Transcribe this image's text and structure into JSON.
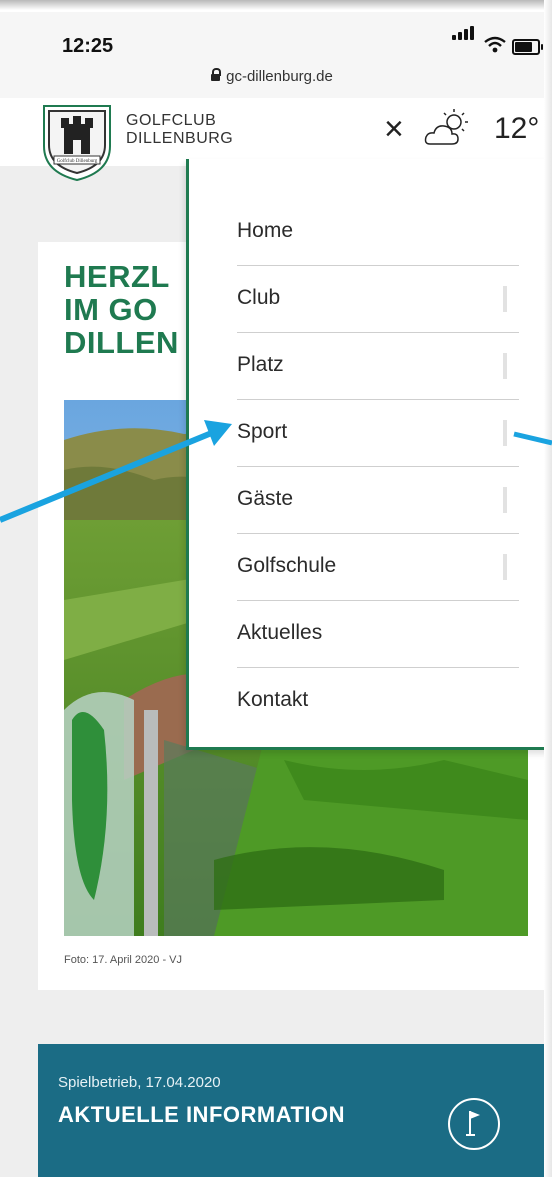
{
  "status_bar": {
    "time": "12:25",
    "url": "gc-dillenburg.de"
  },
  "header": {
    "brand_line1": "GOLFCLUB",
    "brand_line2": "DILLENBURG",
    "logo_text": "Golfclub Dillenburg",
    "close_symbol": "×",
    "temperature": "12°"
  },
  "hero": {
    "headline_lines": [
      "HERZLICH WILLKOMMEN",
      "IM GOLFCLUB",
      "DILLENBURG"
    ],
    "headline_visible": [
      "HERZL",
      "IM GO",
      "DILLEN"
    ],
    "caption": "Foto: 17. April 2020 - VJ"
  },
  "menu": {
    "items": [
      {
        "label": "Home",
        "has_toggle": false
      },
      {
        "label": "Club",
        "has_toggle": true
      },
      {
        "label": "Platz",
        "has_toggle": true
      },
      {
        "label": "Sport",
        "has_toggle": true
      },
      {
        "label": "Gäste",
        "has_toggle": true
      },
      {
        "label": "Golfschule",
        "has_toggle": true
      },
      {
        "label": "Aktuelles",
        "has_toggle": false
      },
      {
        "label": "Kontakt",
        "has_toggle": false
      }
    ]
  },
  "news": {
    "date": "Spielbetrieb, 17.04.2020",
    "title": "AKTUELLE INFORMATION",
    "icon": "flag-icon"
  },
  "colors": {
    "brand_green": "#1f7a50",
    "news_blue": "#1b6c85",
    "annotation_arrow": "#1aa3e0"
  }
}
